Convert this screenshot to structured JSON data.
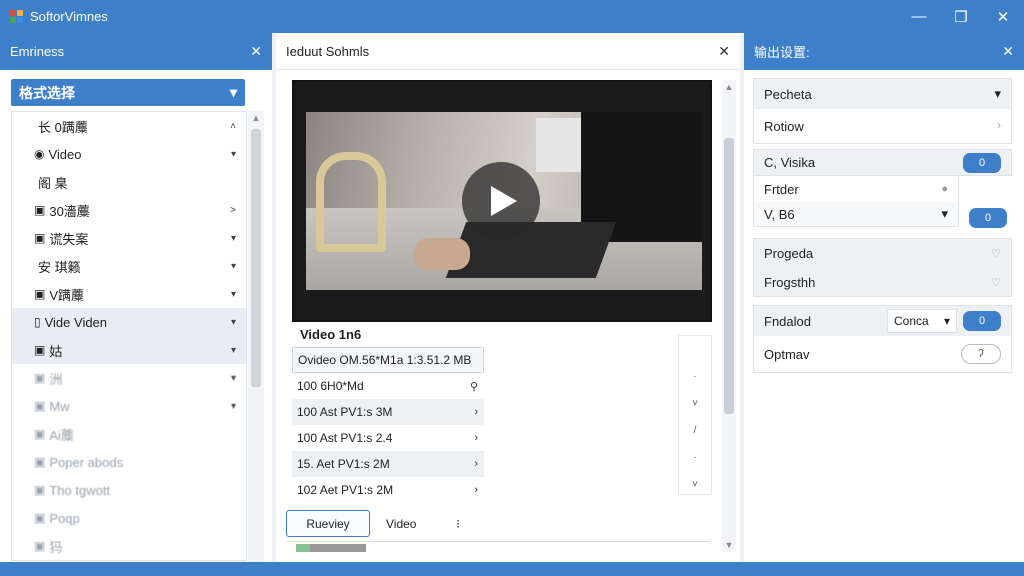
{
  "app": {
    "title": "SoftorVimnes",
    "logo_colors": [
      "#e5483c",
      "#f4b13a",
      "#47a84f",
      "#3a8ee6"
    ],
    "accent": "#3d7fc8"
  },
  "window_controls": {
    "minimize": "—",
    "maximize": "❐",
    "close": "✕"
  },
  "left_panel": {
    "title": "Emriness",
    "close": "✕",
    "format_select": {
      "label": "格式选择",
      "arrow": "▾"
    },
    "items": [
      {
        "icon": "",
        "label": "长 0蹒蘪",
        "chev": "˄",
        "style": ""
      },
      {
        "icon": "◉",
        "label": "Video",
        "chev": "▾",
        "style": ""
      },
      {
        "icon": "",
        "label": "阁 臬",
        "chev": "",
        "style": ""
      },
      {
        "icon": "▣",
        "label": "30濇蘪",
        "chev": "˃",
        "style": ""
      },
      {
        "icon": "▣",
        "label": "谎失案",
        "chev": "▾",
        "style": ""
      },
      {
        "icon": "",
        "label": "安 琪籁",
        "chev": "▾",
        "style": ""
      },
      {
        "icon": "▣",
        "label": "V蹒蘪",
        "chev": "▾",
        "style": ""
      },
      {
        "icon": "▯",
        "label": "Vide Viden",
        "chev": "▾",
        "style": "hl"
      },
      {
        "icon": "▣",
        "label": "姑",
        "chev": "▾",
        "style": "hl"
      },
      {
        "icon": "▣",
        "label": "洲",
        "chev": "▾",
        "style": "dim"
      },
      {
        "icon": "▣",
        "label": "Mw",
        "chev": "▾",
        "style": "dim"
      },
      {
        "icon": "▣",
        "label": "Ai蘪",
        "chev": "",
        "style": "dim"
      },
      {
        "icon": "▣",
        "label": "Poper abods",
        "chev": "",
        "style": "dim"
      },
      {
        "icon": "▣",
        "label": "Tho tgwott",
        "chev": "",
        "style": "dim"
      },
      {
        "icon": "▣",
        "label": "Poqp",
        "chev": "",
        "style": "dim"
      },
      {
        "icon": "▣",
        "label": "犸",
        "chev": "",
        "style": "dim"
      }
    ]
  },
  "middle_panel": {
    "title": "Ieduut Sohmls",
    "close": "✕",
    "video": {
      "title": "Video 1n6",
      "play_icon": "play-icon"
    },
    "files": [
      {
        "name": "Ovideo OM.56*M1a 1:3.51.2 MB",
        "action": ""
      },
      {
        "name": "100 6H0*Md",
        "action": "⚲"
      },
      {
        "name": "100 Ast PV1:s 3M",
        "action": "›"
      },
      {
        "name": "100 Ast PV1:s 2.4",
        "action": "›"
      },
      {
        "name": "15. Aet PV1:s 2M",
        "action": "›"
      },
      {
        "name": "102 Aet PV1:s 2M",
        "action": "›"
      }
    ],
    "side_marks": [
      "",
      "·",
      "˅",
      "/",
      "·",
      "˅"
    ],
    "review_button": "Rueviey",
    "video_dropdown": {
      "value": "Video",
      "arrow": "⁝"
    }
  },
  "right_panel": {
    "title": "输出设置:",
    "close": "✕",
    "group1": [
      {
        "label": "Pecheta",
        "trail": "▾"
      },
      {
        "label": "Rotiow",
        "trail": "›"
      }
    ],
    "group2": {
      "row1_label": "C, Visika",
      "row1_toggle": "0",
      "row2_label": "Frtder",
      "row2_mark": "●",
      "row3_label": "V, B6",
      "row3_arrow": "▾",
      "row3_toggle": "0"
    },
    "group3": [
      {
        "label": "Progeda",
        "trail": "♡"
      },
      {
        "label": "Frogsthh",
        "trail": "♡"
      }
    ],
    "group4": {
      "row1_label": "Fndalod",
      "combo_value": "Conca",
      "combo_arrow": "▾",
      "row1_toggle": "0",
      "row2_label": "Optmav",
      "row2_toggle": "ʔ"
    }
  }
}
